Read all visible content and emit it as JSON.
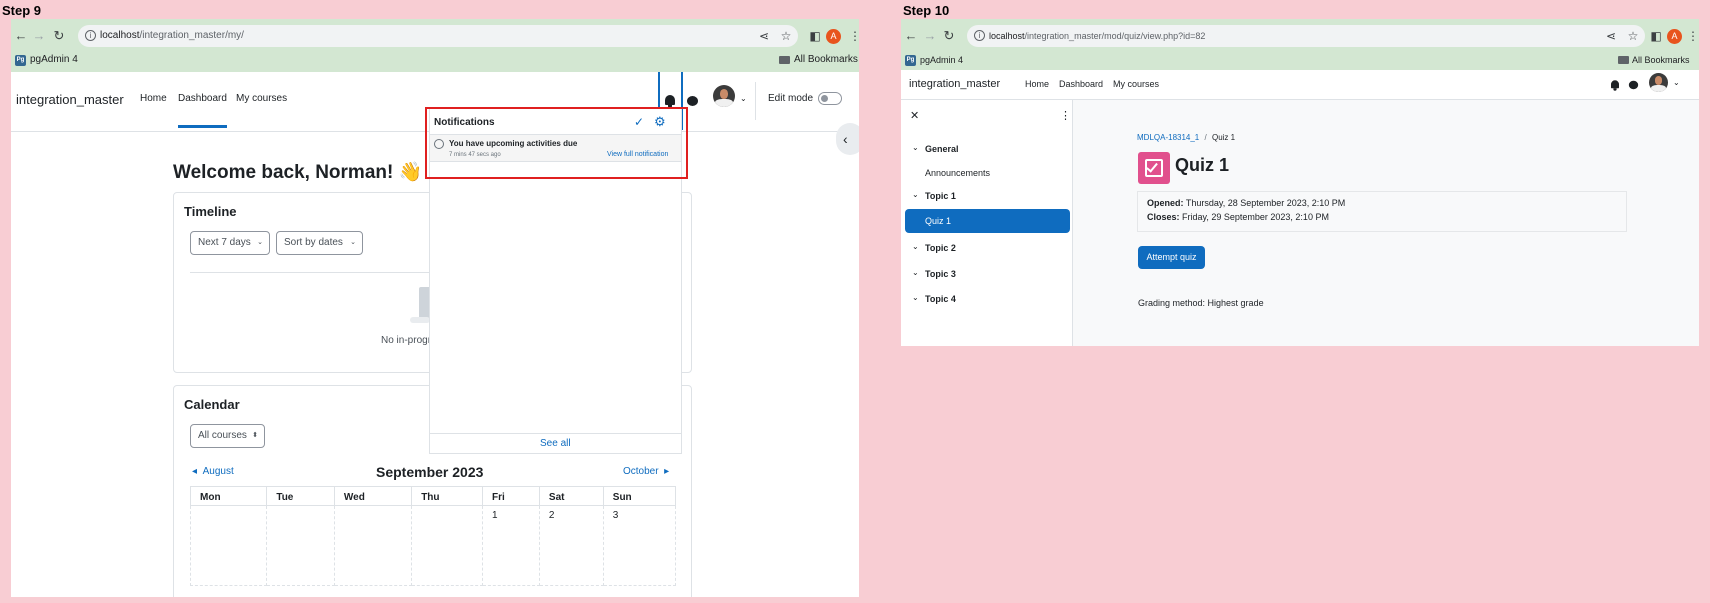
{
  "step9": {
    "label": "Step 9",
    "browser": {
      "url_host": "localhost",
      "url_path": "/integration_master/my/",
      "bookmark": "pgAdmin 4",
      "all_bookmarks": "All Bookmarks",
      "profile_initial": "A"
    },
    "nav": {
      "site_name": "integration_master",
      "links": [
        "Home",
        "Dashboard",
        "My courses"
      ],
      "active_link": "Dashboard",
      "edit_mode": "Edit mode"
    },
    "welcome": "Welcome back, Norman!",
    "wave_emoji": "👋",
    "timeline": {
      "title": "Timeline",
      "filter": "Next 7 days",
      "sort": "Sort by dates",
      "empty_text": "No in-progr"
    },
    "calendar": {
      "title": "Calendar",
      "courses_select": "All courses",
      "prev_month": "August",
      "month": "September 2023",
      "next_month": "October",
      "days": [
        "Mon",
        "Tue",
        "Wed",
        "Thu",
        "Fri",
        "Sat",
        "Sun"
      ],
      "first_week": [
        "",
        "",
        "",
        "",
        "1",
        "2",
        "3"
      ]
    },
    "notifications": {
      "title": "Notifications",
      "item_title": "You have upcoming activities due",
      "item_time": "7 mins 47 secs ago",
      "view_full": "View full notification",
      "see_all": "See all"
    }
  },
  "step10": {
    "label": "Step 10",
    "browser": {
      "url_host": "localhost",
      "url_path": "/integration_master/mod/quiz/view.php?id=82",
      "bookmark": "pgAdmin 4",
      "all_bookmarks": "All Bookmarks",
      "profile_initial": "A"
    },
    "nav": {
      "site_name": "integration_master",
      "links": [
        "Home",
        "Dashboard",
        "My courses"
      ]
    },
    "sidebar": {
      "sections": [
        "General",
        "Topic 1",
        "Topic 2",
        "Topic 3",
        "Topic 4"
      ],
      "general_item": "Announcements",
      "active_item": "Quiz 1"
    },
    "breadcrumb": {
      "course": "MDLQA-18314_1",
      "separator": "/",
      "current": "Quiz 1"
    },
    "quiz": {
      "title": "Quiz 1",
      "opened_label": "Opened:",
      "opened_value": "Thursday, 28 September 2023, 2:10 PM",
      "closes_label": "Closes:",
      "closes_value": "Friday, 29 September 2023, 2:10 PM",
      "attempt_button": "Attempt quiz",
      "grading_method": "Grading method: Highest grade"
    }
  }
}
